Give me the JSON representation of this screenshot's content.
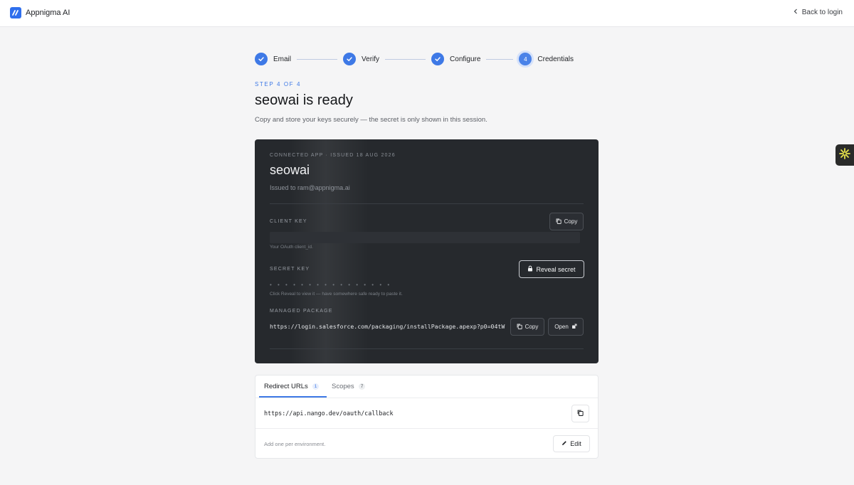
{
  "brand": {
    "name": "Appnigma AI"
  },
  "nav": {
    "back_label": "Back to login"
  },
  "stepper": {
    "steps": [
      {
        "label": "Email",
        "state": "done"
      },
      {
        "label": "Verify",
        "state": "done"
      },
      {
        "label": "Configure",
        "state": "done"
      },
      {
        "label": "Credentials",
        "state": "current",
        "number": "4"
      }
    ]
  },
  "header": {
    "kicker": "STEP 4 OF 4",
    "title": "seowai is ready",
    "subtitle": "Copy and store your keys securely — the secret is only shown in this session."
  },
  "card": {
    "meta": "CONNECTED APP · ISSUED 18 AUG 2026",
    "app_name": "seowai",
    "issued_to": "Issued to ram@appnigma.ai",
    "client_key": {
      "label": "CLIENT KEY",
      "copy_label": "Copy",
      "hint": "Your OAuth client_id."
    },
    "secret_key": {
      "label": "SECRET KEY",
      "reveal_label": "Reveal secret",
      "masked": "• • • • • • • • • • • • • • • •",
      "hint": "Click Reveal to view it — have somewhere safe ready to paste it."
    },
    "package": {
      "label": "MANAGED PACKAGE",
      "url": "https://login.salesforce.com/packaging/installPackage.apexp?p0=04tW",
      "copy_label": "Copy",
      "open_label": "Open"
    }
  },
  "tabs": {
    "items": [
      {
        "label": "Redirect URLs",
        "count": "1",
        "active": true
      },
      {
        "label": "Scopes",
        "count": "7",
        "active": false
      }
    ],
    "redirect_url": "https://api.nango.dev/oauth/callback",
    "footer_hint": "Add one per environment.",
    "edit_label": "Edit"
  },
  "colors": {
    "accent": "#3e79e6",
    "card_dark": "#26292d",
    "page_bg": "#f5f5f6"
  }
}
